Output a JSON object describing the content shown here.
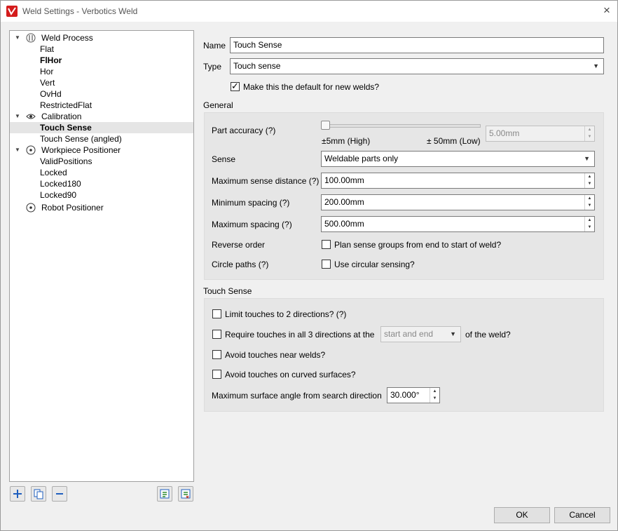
{
  "window": {
    "title": "Weld Settings - Verbotics Weld",
    "close_glyph": "×"
  },
  "tree": {
    "groups": [
      {
        "label": "Weld Process",
        "icon": "weld-process-icon",
        "children": [
          "Flat",
          "FlHor",
          "Hor",
          "Vert",
          "OvHd",
          "RestrictedFlat"
        ]
      },
      {
        "label": "Calibration",
        "icon": "eye-icon",
        "children": [
          "Touch Sense",
          "Touch Sense (angled)"
        ]
      },
      {
        "label": "Workpiece Positioner",
        "icon": "positioner-icon",
        "children": [
          "ValidPositions",
          "Locked",
          "Locked180",
          "Locked90"
        ]
      },
      {
        "label": "Robot Positioner",
        "icon": "positioner-icon",
        "children": []
      }
    ],
    "selected": "Touch Sense",
    "bold_item": "FlHor"
  },
  "toolbar": {
    "add_icon": "plus-icon",
    "duplicate_icon": "copy-icon",
    "remove_icon": "minus-icon",
    "import_icon": "import-icon",
    "export_icon": "export-icon"
  },
  "form": {
    "name_label": "Name",
    "name_value": "Touch Sense",
    "type_label": "Type",
    "type_value": "Touch sense",
    "default_label": "Make this the default for new welds?",
    "default_checked": true
  },
  "general": {
    "title": "General",
    "part_accuracy_label": "Part accuracy (?)",
    "slider_min_label": "±5mm (High)",
    "slider_max_label": "± 50mm (Low)",
    "part_accuracy_value": "5.00mm",
    "sense_label": "Sense",
    "sense_value": "Weldable parts only",
    "max_sense_distance_label": "Maximum sense distance (?)",
    "max_sense_distance_value": "100.00mm",
    "min_spacing_label": "Minimum spacing (?)",
    "min_spacing_value": "200.00mm",
    "max_spacing_label": "Maximum spacing (?)",
    "max_spacing_value": "500.00mm",
    "reverse_order_label": "Reverse order",
    "reverse_order_check": "Plan sense groups from end to start of weld?",
    "circle_paths_label": "Circle paths (?)",
    "circle_paths_check": "Use circular sensing?"
  },
  "touch_sense": {
    "title": "Touch Sense",
    "limit_touches": "Limit touches to 2 directions? (?)",
    "require_touches_prefix": "Require touches in all 3 directions at the",
    "require_touches_combo": "start and end",
    "require_touches_suffix": "of the weld?",
    "avoid_near_welds": "Avoid touches near welds?",
    "avoid_curved": "Avoid touches on curved surfaces?",
    "max_angle_label": "Maximum surface angle from search direction",
    "max_angle_value": "30.000°"
  },
  "buttons": {
    "ok": "OK",
    "cancel": "Cancel"
  },
  "colors": {
    "accent": "#d41c1c",
    "selection": "#e5e5e5",
    "group_bg": "#e6e6e6"
  }
}
